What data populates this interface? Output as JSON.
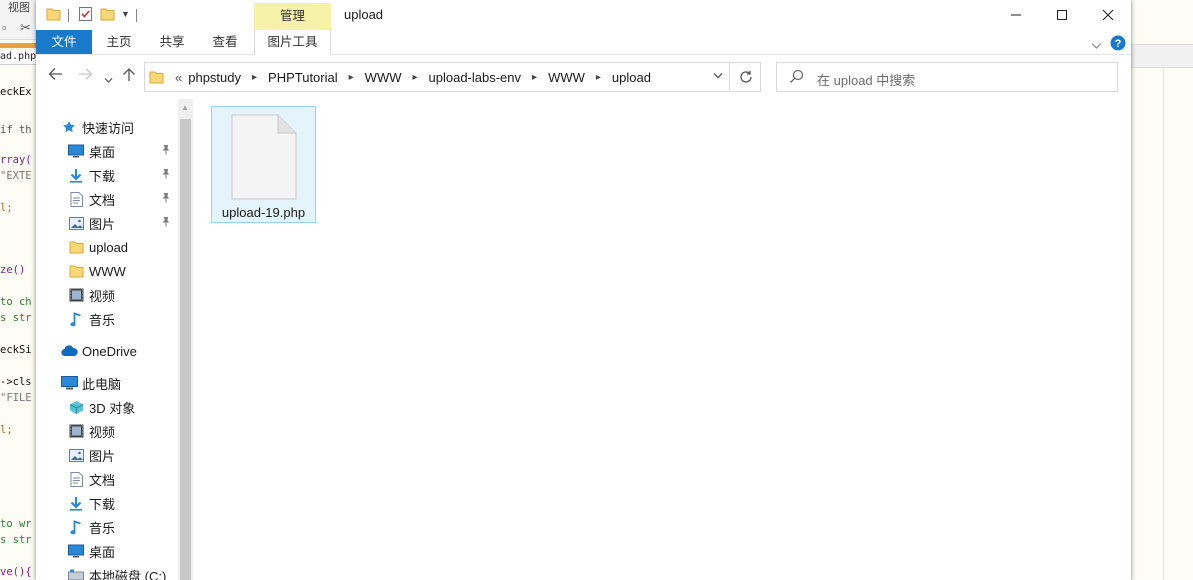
{
  "background_editor": {
    "menu_label": "视图",
    "tab_label": "ad.php",
    "code_lines": [
      {
        "text": "eckEx",
        "color": "#111111"
      },
      {
        "text": "if th",
        "color": "#555555"
      },
      {
        "text": "rray(",
        "color": "#8b1a8b"
      },
      {
        "text": "\"EXTE",
        "color": "#777777"
      },
      {
        "text": "l;",
        "color": "#b07020"
      },
      {
        "text": "ze()",
        "color": "#8b1a8b"
      },
      {
        "text": "to ch",
        "color": "#2f7d2f"
      },
      {
        "text": "s str",
        "color": "#2f7d2f"
      },
      {
        "text": "eckSi",
        "color": "#111111"
      },
      {
        "text": "->cls",
        "color": "#111111"
      },
      {
        "text": "\"FILE",
        "color": "#777777"
      },
      {
        "text": "l;",
        "color": "#b07020"
      },
      {
        "text": "to wr",
        "color": "#2f7d2f"
      },
      {
        "text": "s str",
        "color": "#2f7d2f"
      },
      {
        "text": "ve(){",
        "color": "#8b1a8b"
      }
    ]
  },
  "window": {
    "title": "upload",
    "context_tab_group": "管理",
    "caption_buttons": [
      "minimize",
      "maximize",
      "close"
    ]
  },
  "ribbon": {
    "tabs": [
      "文件",
      "主页",
      "共享",
      "查看",
      "图片工具"
    ]
  },
  "address_bar": {
    "overflow": "«",
    "crumbs": [
      "phpstudy",
      "PHPTutorial",
      "WWW",
      "upload-labs-env",
      "WWW",
      "upload"
    ]
  },
  "search": {
    "placeholder": "在 upload 中搜索"
  },
  "nav_pane": {
    "items": [
      {
        "label": "快速访问",
        "icon": "star-icon",
        "level": 0,
        "pinned": false
      },
      {
        "label": "桌面",
        "icon": "desktop-icon",
        "level": 1,
        "pinned": true
      },
      {
        "label": "下载",
        "icon": "download-icon",
        "level": 1,
        "pinned": true
      },
      {
        "label": "文档",
        "icon": "document-icon",
        "level": 1,
        "pinned": true
      },
      {
        "label": "图片",
        "icon": "picture-icon",
        "level": 1,
        "pinned": true
      },
      {
        "label": "upload",
        "icon": "folder-icon",
        "level": 1,
        "pinned": false
      },
      {
        "label": "WWW",
        "icon": "folder-icon",
        "level": 1,
        "pinned": false
      },
      {
        "label": "视频",
        "icon": "video-icon",
        "level": 1,
        "pinned": false
      },
      {
        "label": "音乐",
        "icon": "music-icon",
        "level": 1,
        "pinned": false
      },
      {
        "label": "OneDrive",
        "icon": "cloud-icon",
        "level": 0,
        "pinned": false
      },
      {
        "label": "此电脑",
        "icon": "computer-icon",
        "level": 0,
        "pinned": false
      },
      {
        "label": "3D 对象",
        "icon": "cube-icon",
        "level": 1,
        "pinned": false
      },
      {
        "label": "视频",
        "icon": "video-icon",
        "level": 1,
        "pinned": false
      },
      {
        "label": "图片",
        "icon": "picture-icon",
        "level": 1,
        "pinned": false
      },
      {
        "label": "文档",
        "icon": "document-icon",
        "level": 1,
        "pinned": false
      },
      {
        "label": "下载",
        "icon": "download-icon",
        "level": 1,
        "pinned": false
      },
      {
        "label": "音乐",
        "icon": "music-icon",
        "level": 1,
        "pinned": false
      },
      {
        "label": "桌面",
        "icon": "desktop-icon",
        "level": 1,
        "pinned": false
      },
      {
        "label": "本地磁盘 (C:)",
        "icon": "drive-icon",
        "level": 1,
        "pinned": false
      }
    ]
  },
  "files": [
    {
      "name": "upload-19.php",
      "icon": "generic-file-icon",
      "selected": true
    }
  ],
  "colors": {
    "accent": "#1979ca",
    "context_tab": "#f6f3a8",
    "selection_fill": "#e5f3fb",
    "selection_border": "#99d1f0",
    "folder": "#f8d775"
  }
}
